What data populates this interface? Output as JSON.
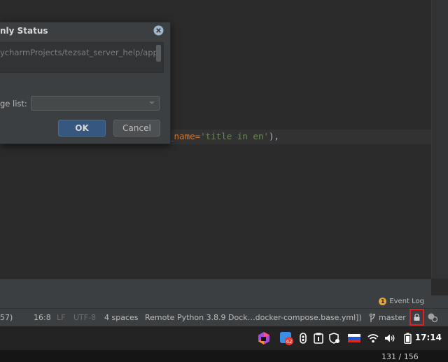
{
  "dialog": {
    "title": "nly Status",
    "path": "ycharmProjects/tezsat_server_help/app",
    "select_label": "ge list:",
    "combo_value": "",
    "ok_label": "OK",
    "cancel_label": "Cancel"
  },
  "editor": {
    "code_prefix": "_name=",
    "code_string": "'title in en'",
    "code_suffix": "),"
  },
  "event_log": {
    "badge": "1",
    "label": "Event Log"
  },
  "statusbar": {
    "partial": "57)",
    "position": "16:8",
    "line_sep": "LF",
    "encoding": "UTF-8",
    "indent": "4 spaces",
    "interpreter": "Remote Python 3.8.9 Dock…docker-compose.base.yml])",
    "branch": "master"
  },
  "taskbar": {
    "notification_count": "42",
    "clock": "17:14",
    "icons": [
      "jetbrains-toolbox-icon",
      "app-icon",
      "dropbox-icon",
      "clipboard-icon",
      "shield-icon",
      "russian-flag-icon",
      "wifi-icon",
      "volume-icon",
      "battery-icon"
    ]
  },
  "pager": {
    "page": "131 / 156"
  },
  "colors": {
    "accent_button": "#365880",
    "highlight_border": "#e02020",
    "string": "#6a8759",
    "keyword": "#cc7832"
  }
}
